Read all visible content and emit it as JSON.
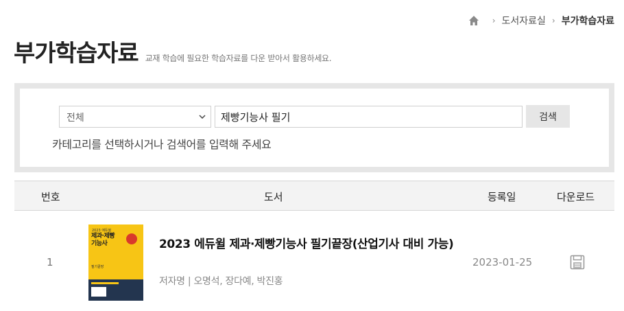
{
  "breadcrumb": {
    "home_icon": "home-icon",
    "items": [
      "도서자료실",
      "부가학습자료"
    ]
  },
  "page": {
    "title": "부가학습자료",
    "description": "교재 학습에 필요한 학습자료를 다운 받아서 활용하세요."
  },
  "search": {
    "category_selected": "전체",
    "query_value": "제빵기능사 필기",
    "button_label": "검색",
    "hint": "카테고리를 선택하시거나 검색어를 입력해 주세요"
  },
  "table": {
    "headers": {
      "no": "번호",
      "book": "도서",
      "date": "등록일",
      "download": "다운로드"
    },
    "rows": [
      {
        "no": "1",
        "title": "2023 에듀윌 제과·제빵기능사 필기끝장(산업기사 대비 가능)",
        "authors": "저자명 | 오명석, 장다예, 박진홍",
        "date": "2023-01-25",
        "download_icon": "floppy-disk-icon"
      }
    ]
  },
  "cover": {
    "line1": "2023 에듀윌",
    "line2a": "제과·제빵",
    "line2b": "기능사",
    "line3": "필기끝장",
    "color_bg": "#f7c515",
    "color_band": "#23354f"
  }
}
